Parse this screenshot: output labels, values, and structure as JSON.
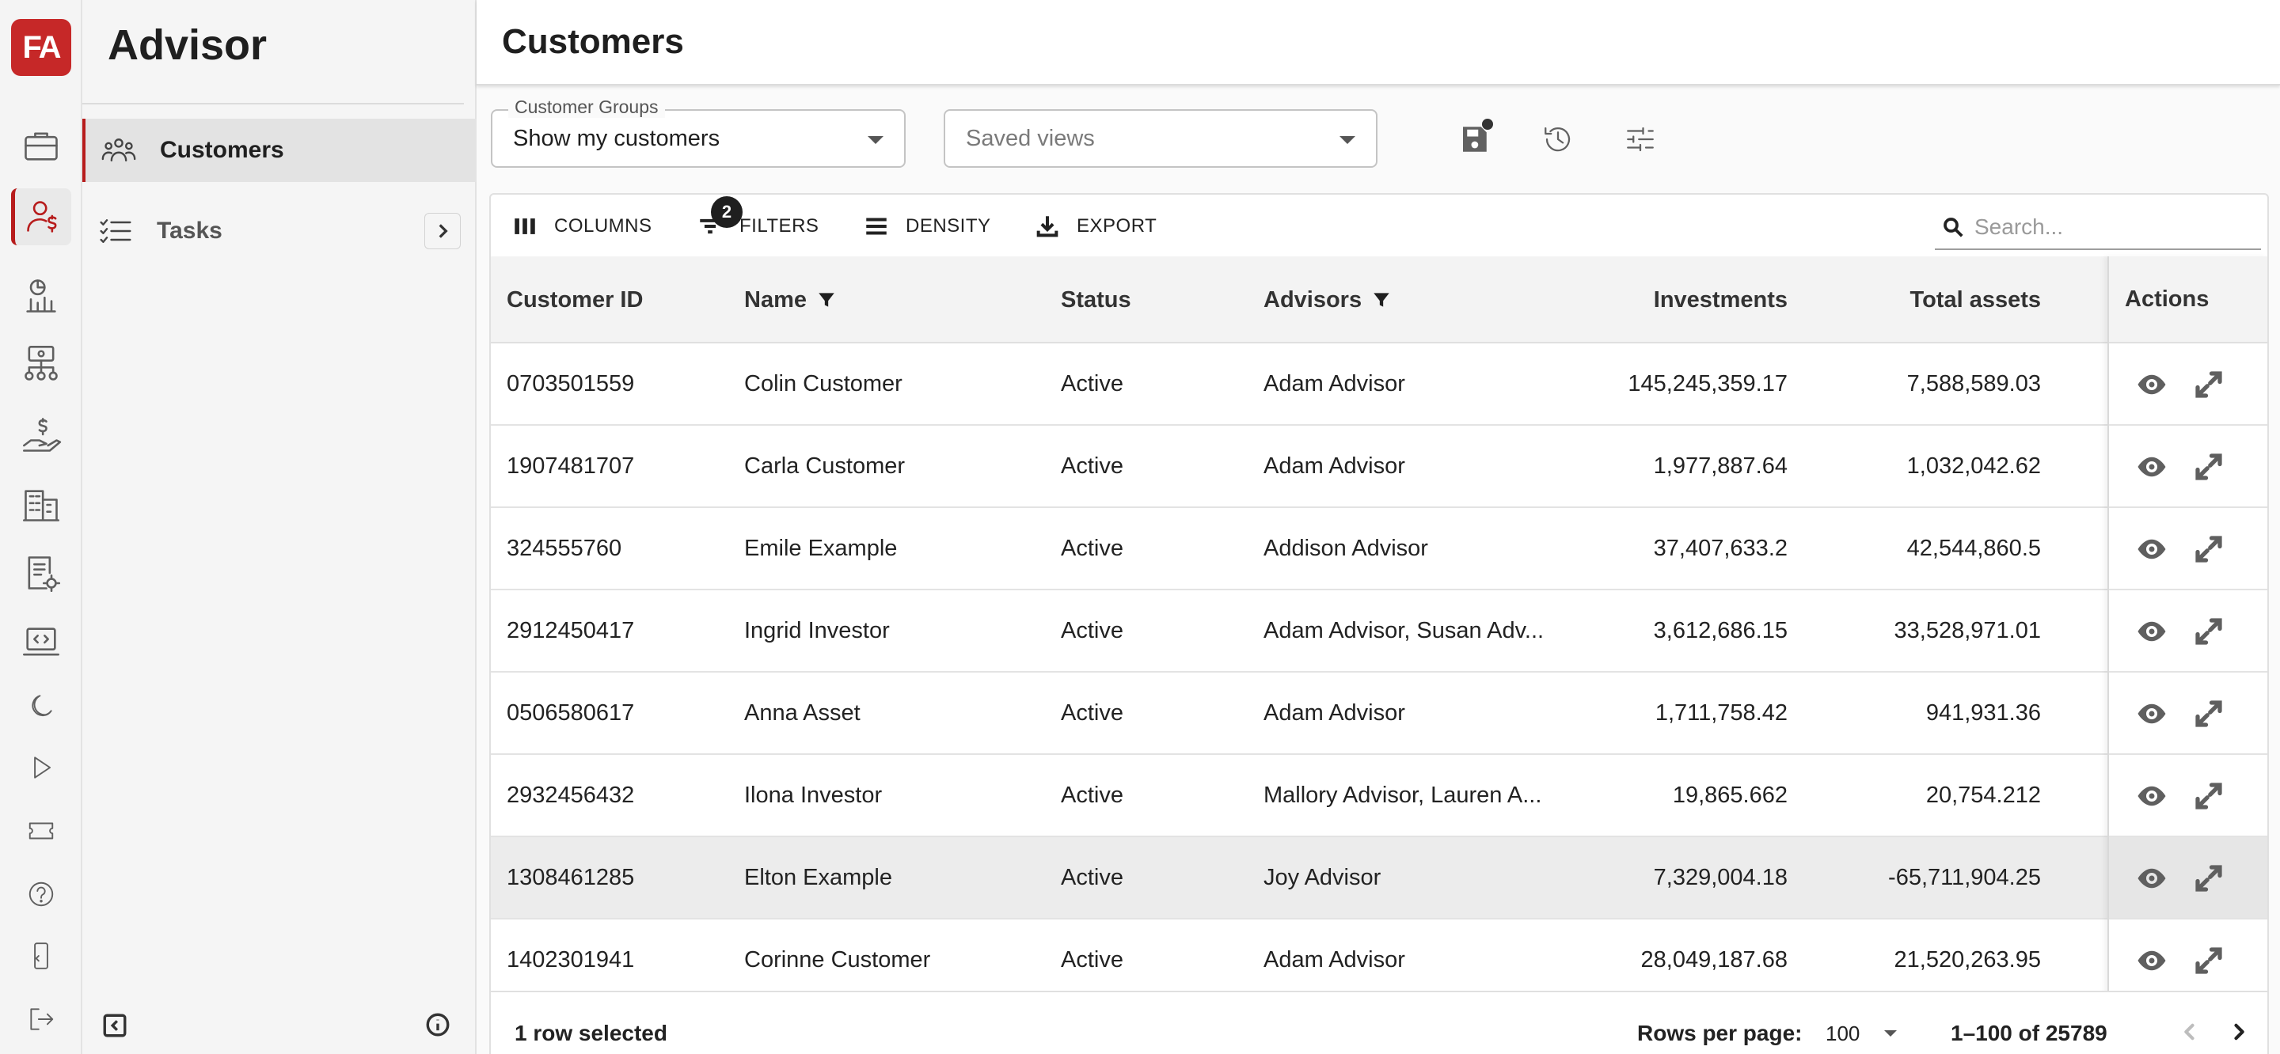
{
  "rail": {
    "logo_text": "FA",
    "items": [
      {
        "icon": "briefcase-icon"
      },
      {
        "icon": "customer-dollar-icon",
        "active": true
      },
      {
        "icon": "report-chart-icon"
      },
      {
        "icon": "money-network-icon"
      },
      {
        "icon": "hand-dollar-icon"
      },
      {
        "icon": "building-icon"
      },
      {
        "icon": "doc-settings-icon"
      },
      {
        "icon": "laptop-code-icon"
      },
      {
        "icon": "moon-icon"
      },
      {
        "icon": "play-icon"
      },
      {
        "icon": "ticket-icon"
      },
      {
        "icon": "help-icon"
      },
      {
        "icon": "mobile-icon"
      },
      {
        "icon": "logout-icon"
      }
    ],
    "accent": "#b71c1c"
  },
  "sidebar": {
    "app_title": "Advisor",
    "items": [
      {
        "label": "Customers",
        "icon": "people-group-icon",
        "active": true
      },
      {
        "label": "Tasks",
        "icon": "checklist-icon",
        "active": false
      }
    ]
  },
  "header": {
    "title": "Customers"
  },
  "filters": {
    "customer_groups_label": "Customer Groups",
    "customer_groups_value": "Show my customers",
    "saved_views_placeholder": "Saved views"
  },
  "toolbar": {
    "columns": "COLUMNS",
    "filters": "FILTERS",
    "filters_badge": "2",
    "density": "DENSITY",
    "export": "EXPORT",
    "search_placeholder": "Search..."
  },
  "table": {
    "columns": [
      "Customer ID",
      "Name",
      "Status",
      "Advisors",
      "Investments",
      "Total assets",
      "Actions"
    ],
    "rows": [
      {
        "id": "0703501559",
        "name": "Colin Customer",
        "status": "Active",
        "advisors": "Adam Advisor",
        "investments": "145,245,359.17",
        "total": "7,588,589.03"
      },
      {
        "id": "1907481707",
        "name": "Carla Customer",
        "status": "Active",
        "advisors": "Adam Advisor",
        "investments": "1,977,887.64",
        "total": "1,032,042.62"
      },
      {
        "id": "324555760",
        "name": "Emile Example",
        "status": "Active",
        "advisors": "Addison Advisor",
        "investments": "37,407,633.2",
        "total": "42,544,860.5"
      },
      {
        "id": "2912450417",
        "name": "Ingrid Investor",
        "status": "Active",
        "advisors": "Adam Advisor, Susan Adv...",
        "investments": "3,612,686.15",
        "total": "33,528,971.01"
      },
      {
        "id": "0506580617",
        "name": "Anna Asset",
        "status": "Active",
        "advisors": "Adam Advisor",
        "investments": "1,711,758.42",
        "total": "941,931.36"
      },
      {
        "id": "2932456432",
        "name": "Ilona Investor",
        "status": "Active",
        "advisors": "Mallory Advisor, Lauren A...",
        "investments": "19,865.662",
        "total": "20,754.212"
      },
      {
        "id": "1308461285",
        "name": "Elton Example",
        "status": "Active",
        "advisors": "Joy Advisor",
        "investments": "7,329,004.18",
        "total": "-65,711,904.25",
        "selected": true
      },
      {
        "id": "1402301941",
        "name": "Corinne Customer",
        "status": "Active",
        "advisors": "Adam Advisor",
        "investments": "28,049,187.68",
        "total": "21,520,263.95"
      }
    ]
  },
  "footer": {
    "selected_text": "1 row selected",
    "rows_per_page_label": "Rows per page:",
    "rows_per_page_value": "100",
    "page_range": "1–100 of 25789"
  }
}
